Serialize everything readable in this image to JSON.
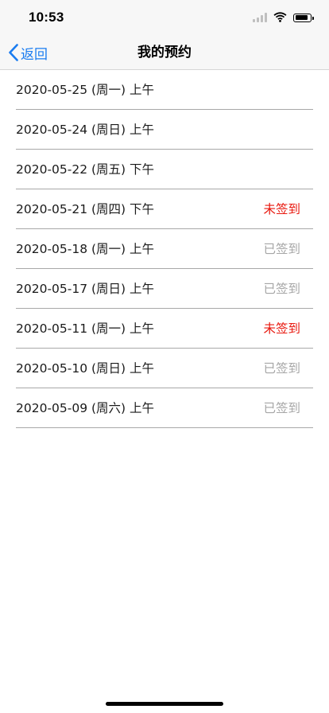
{
  "status_bar": {
    "time": "10:53",
    "battery_level": 0.9
  },
  "nav": {
    "back_label": "返回",
    "title": "我的预约"
  },
  "colors": {
    "accent": "#1a7cf0",
    "status_unchecked": "#e8190f",
    "status_checked": "#a6a6a6"
  },
  "appointments": [
    {
      "date": "2020-05-25 (周一) 上午",
      "status": ""
    },
    {
      "date": "2020-05-24 (周日) 上午",
      "status": ""
    },
    {
      "date": "2020-05-22 (周五) 下午",
      "status": ""
    },
    {
      "date": "2020-05-21 (周四) 下午",
      "status": "未签到"
    },
    {
      "date": "2020-05-18 (周一) 上午",
      "status": "已签到"
    },
    {
      "date": "2020-05-17 (周日) 上午",
      "status": "已签到"
    },
    {
      "date": "2020-05-11 (周一) 上午",
      "status": "未签到"
    },
    {
      "date": "2020-05-10 (周日) 上午",
      "status": "已签到"
    },
    {
      "date": "2020-05-09 (周六) 上午",
      "status": "已签到"
    }
  ]
}
